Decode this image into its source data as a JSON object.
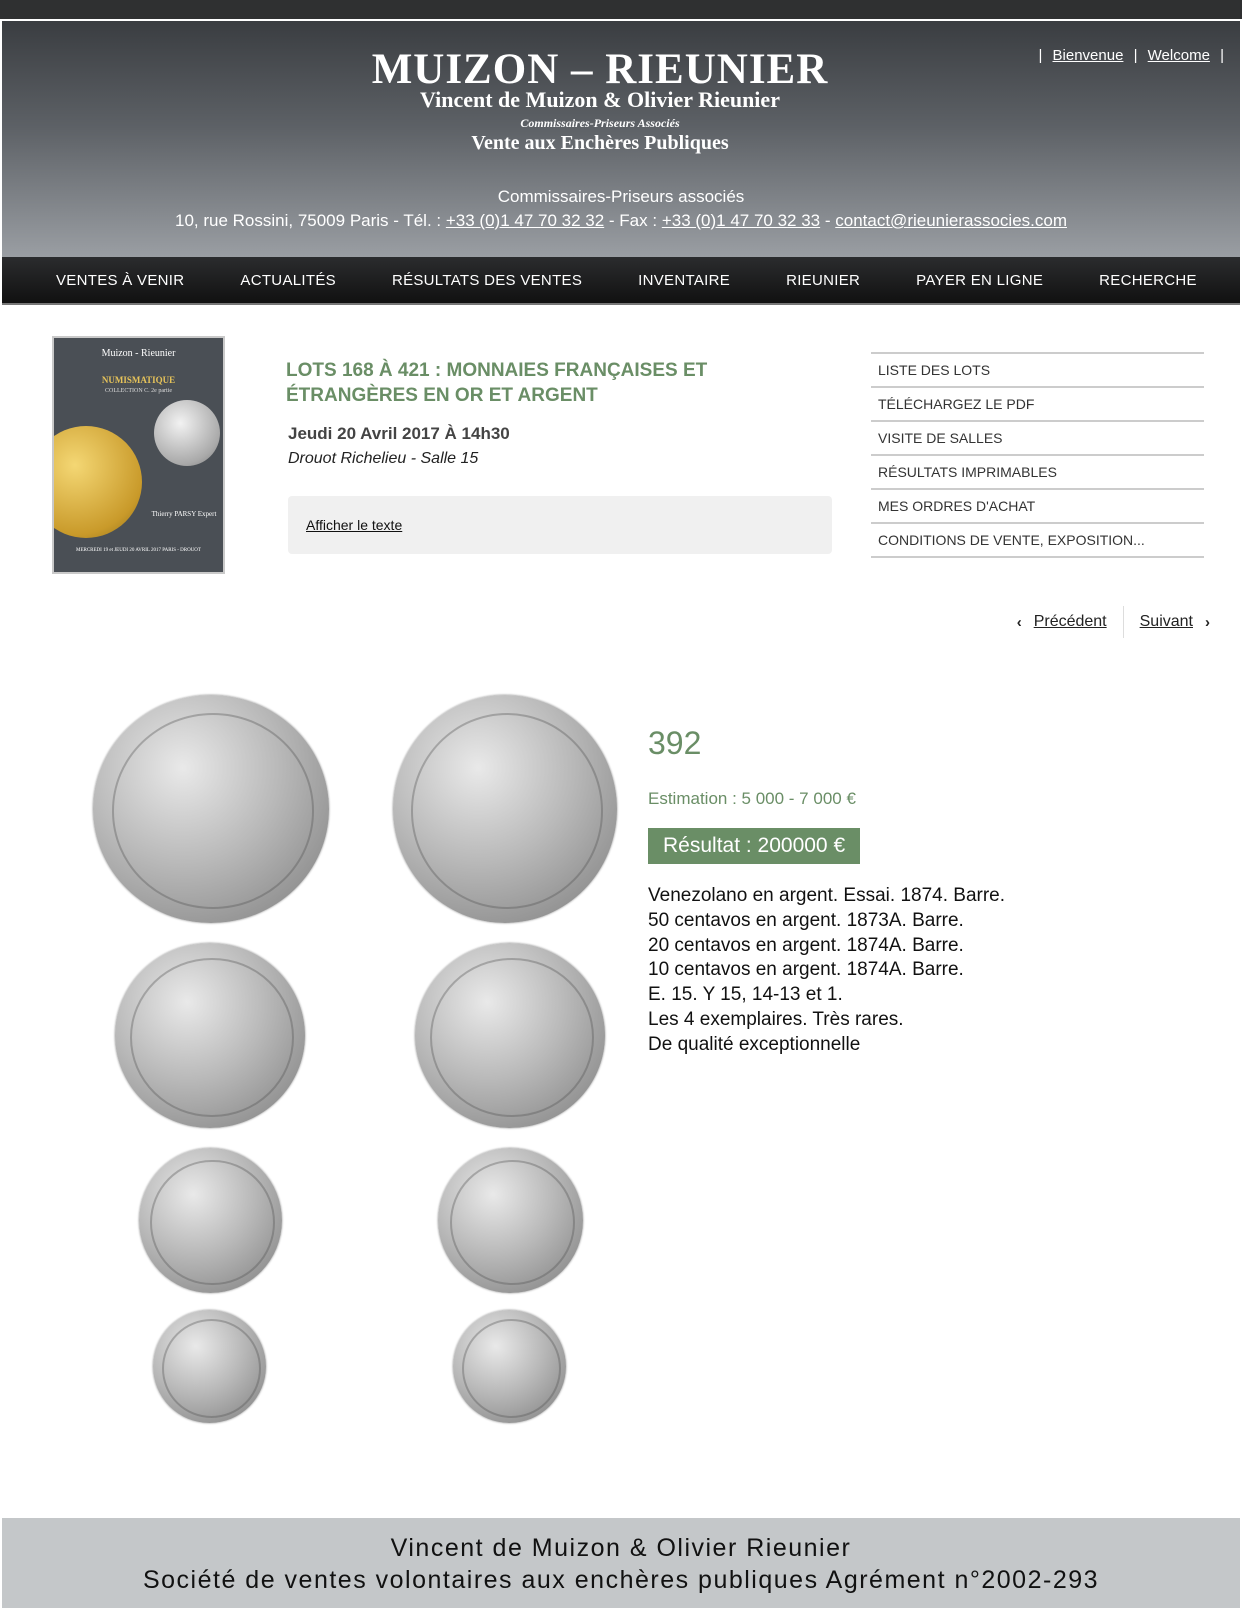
{
  "header": {
    "logo_main": "MUIZON – RIEUNIER",
    "logo_sub": "Vincent de Muizon & Olivier Rieunier",
    "logo_sub2": "Commissaires-Priseurs Associés",
    "logo_sub3": "Vente aux Enchères Publiques",
    "lang_bienvenue": "Bienvenue",
    "lang_welcome": "Welcome",
    "lang_sep": "|",
    "contact_title": "Commissaires-Priseurs associés",
    "address": "10, rue Rossini, 75009 Paris - Tél. : ",
    "phone": "+33 (0)1 47 70 32 32",
    "fax_label": " - Fax : ",
    "fax": "+33 (0)1 47 70 32 33",
    "email_sep": " - ",
    "email": "contact@rieunierassocies.com"
  },
  "nav": {
    "items": [
      "VENTES À VENIR",
      "ACTUALITÉS",
      "RÉSULTATS DES VENTES",
      "INVENTAIRE",
      "RIEUNIER",
      "PAYER EN LIGNE",
      "RECHERCHE"
    ]
  },
  "catalog_cover": {
    "line1": "Muizon - Rieunier",
    "line2": "NUMISMATIQUE",
    "line3": "COLLECTION C. 2e partie",
    "line4": "Thierry PARSY Expert",
    "line5": "MERCREDI 19 et JEUDI 20 AVRIL 2017 PARIS - DROUOT"
  },
  "sale": {
    "title": "LOTS 168 À 421 : MONNAIES FRANÇAISES ET ÉTRANGÈRES EN OR ET ARGENT",
    "date": "Jeudi 20 Avril 2017 À 14h30",
    "place": "Drouot Richelieu - Salle 15",
    "show_text": "Afficher le texte"
  },
  "side_menu": {
    "items": [
      "LISTE DES LOTS",
      "TÉLÉCHARGEZ LE PDF",
      "VISITE DE SALLES",
      "RÉSULTATS IMPRIMABLES",
      "MES ORDRES D'ACHAT",
      "CONDITIONS DE VENTE, EXPOSITION..."
    ]
  },
  "pager": {
    "prev": "Précédent",
    "next": "Suivant",
    "prev_icon": "chevron-left-icon",
    "next_icon": "chevron-right-icon"
  },
  "lot": {
    "number": "392",
    "estimate": "Estimation : 5 000 - 7 000 €",
    "result": "Résultat : 200000 €",
    "description": [
      "Venezolano en argent. Essai. 1874. Barre.",
      "50 centavos en argent. 1873A. Barre.",
      "20 centavos en argent. 1874A. Barre.",
      "10 centavos en argent. 1874A. Barre.",
      "E. 15. Y 15, 14-13 et 1.",
      "Les 4 exemplaires. Très rares.",
      "De qualité exceptionnelle"
    ]
  },
  "footer": {
    "line1": "Vincent de Muizon & Olivier Rieunier",
    "line2": "Société de ventes volontaires aux enchères publiques Agrément n°2002-293"
  },
  "colors": {
    "accent_green": "#6a8e66",
    "nav_bg": "#1c1d1f",
    "footer_bg": "#c4c7c9"
  }
}
